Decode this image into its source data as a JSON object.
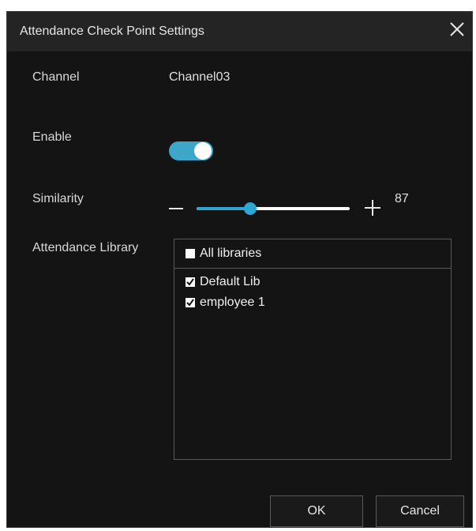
{
  "dialog": {
    "title": "Attendance Check Point Settings",
    "close_icon": "close-icon"
  },
  "form": {
    "channel_label": "Channel",
    "channel_value": "Channel03",
    "enable_label": "Enable",
    "enable_on": true,
    "similarity_label": "Similarity",
    "similarity_value": "87",
    "similarity_percent": 0.87,
    "library_label": "Attendance Library"
  },
  "library": {
    "all_label": "All libraries",
    "all_checked": false,
    "items": [
      {
        "label": "Default Lib",
        "checked": true
      },
      {
        "label": "employee 1",
        "checked": true
      }
    ]
  },
  "buttons": {
    "ok": "OK",
    "cancel": "Cancel"
  },
  "colors": {
    "accent": "#2ea7d4",
    "toggle_on": "#3ea6c8",
    "dialog_bg": "#141414",
    "titlebar_bg": "#242424"
  }
}
